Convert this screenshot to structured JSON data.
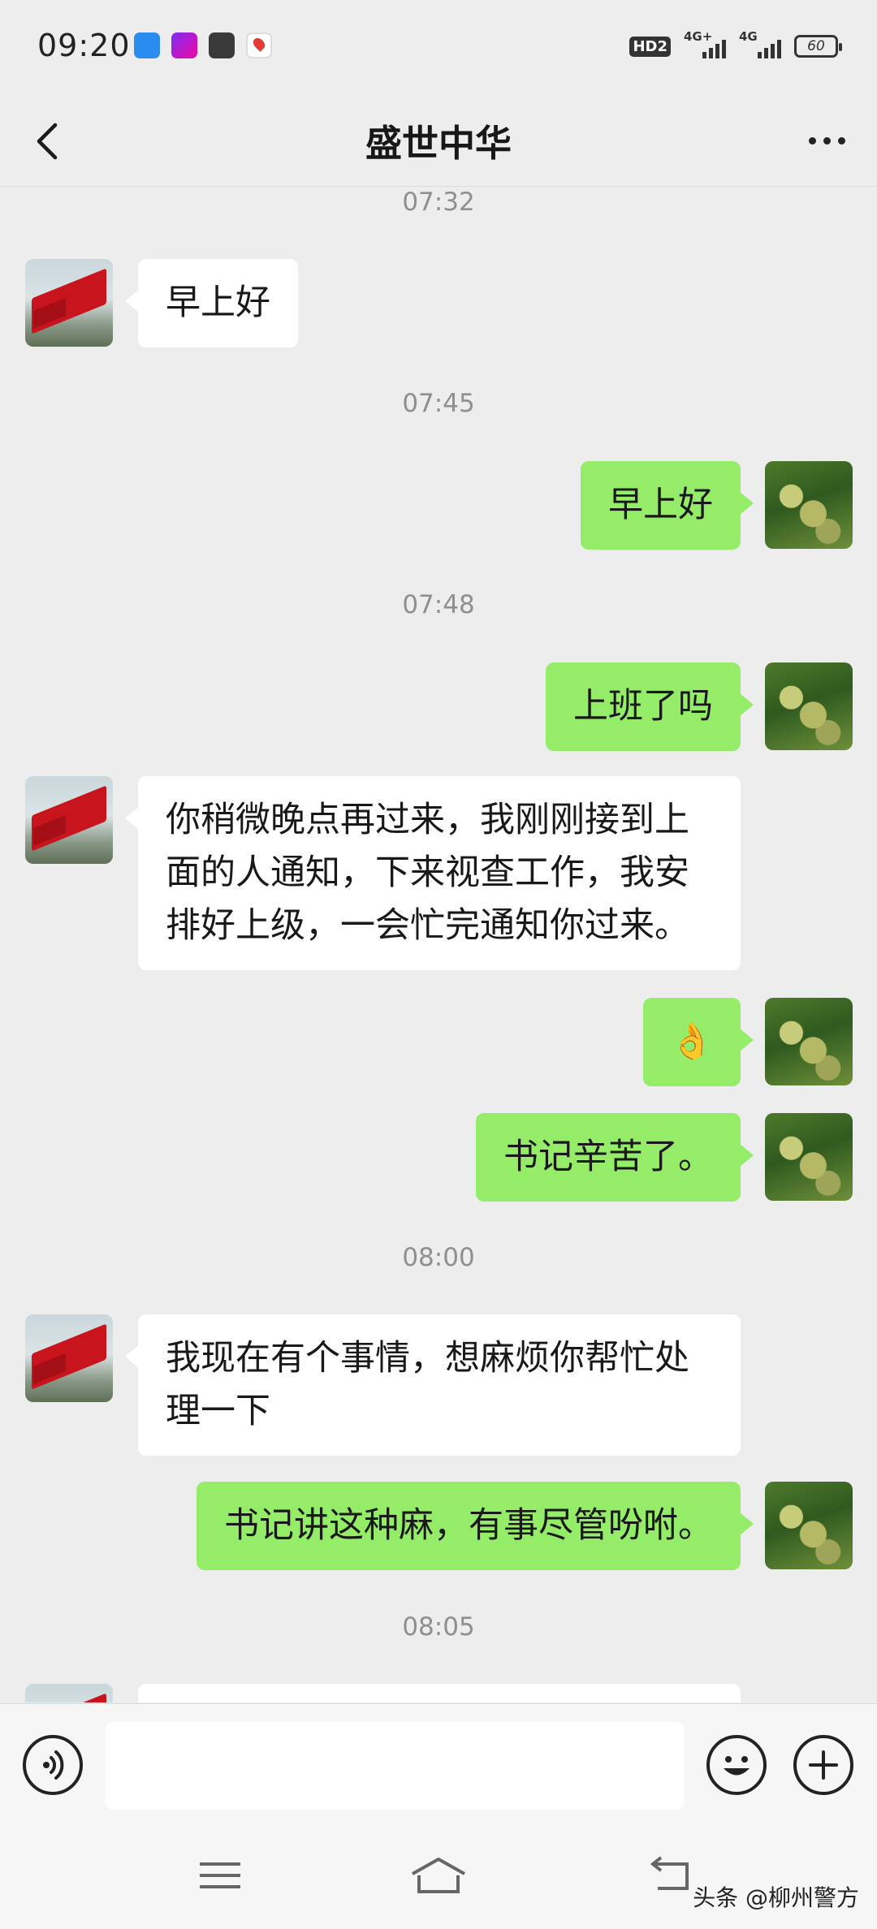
{
  "status_bar": {
    "time": "09:20",
    "hd_label": "HD2",
    "network_1": "4G+",
    "network_2": "4G",
    "battery": "60"
  },
  "header": {
    "title": "盛世中华"
  },
  "messages": [
    {
      "type": "timestamp",
      "text": "07:32"
    },
    {
      "type": "received",
      "text": "早上好"
    },
    {
      "type": "timestamp",
      "text": "07:45"
    },
    {
      "type": "sent",
      "text": "早上好"
    },
    {
      "type": "timestamp",
      "text": "07:48"
    },
    {
      "type": "sent",
      "text": "上班了吗"
    },
    {
      "type": "received",
      "text": "你稍微晚点再过来，我刚刚接到上面的人通知，下来视查工作，我安排好上级，一会忙完通知你过来。"
    },
    {
      "type": "sent",
      "text": "👌"
    },
    {
      "type": "sent",
      "text": "书记辛苦了。"
    },
    {
      "type": "timestamp",
      "text": "08:00"
    },
    {
      "type": "received",
      "text": "我现在有个事情，想麻烦你帮忙处理一下"
    },
    {
      "type": "sent",
      "text": "书记讲这种麻，有事尽管吩咐。"
    },
    {
      "type": "timestamp",
      "text": "08:05"
    }
  ],
  "input_bar": {
    "placeholder": ""
  },
  "watermark": "头条 @柳州警方",
  "colors": {
    "background": "#ededed",
    "sent_bubble": "#95ec69",
    "received_bubble": "#ffffff",
    "timestamp": "#8f8f8f"
  }
}
